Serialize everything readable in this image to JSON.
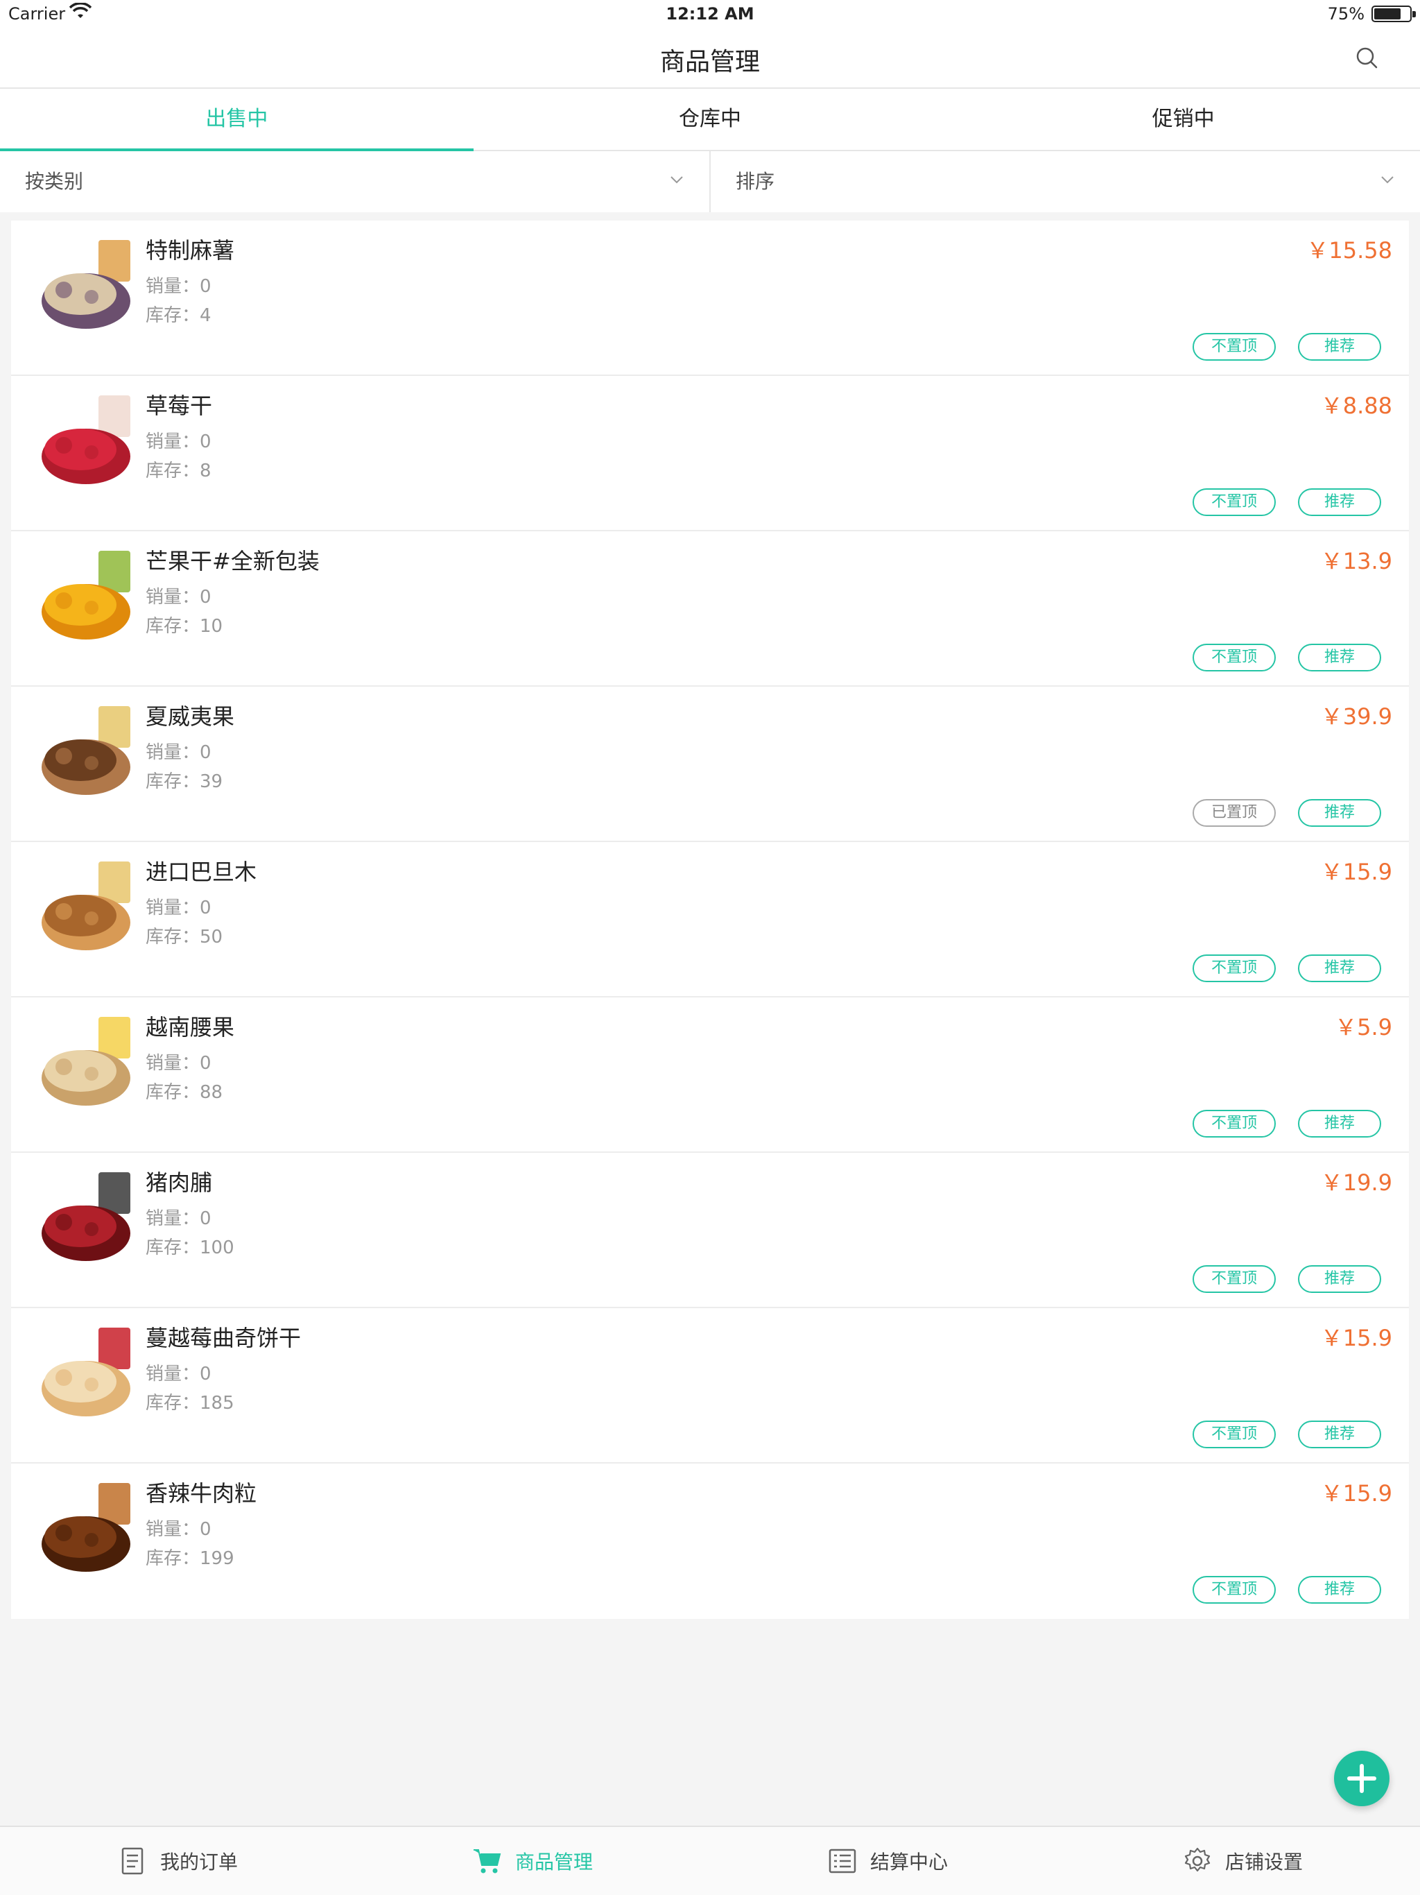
{
  "status_bar": {
    "carrier": "Carrier",
    "time": "12:12 AM",
    "battery": "75%"
  },
  "header": {
    "title": "商品管理"
  },
  "tabs": [
    {
      "label": "出售中"
    },
    {
      "label": "仓库中"
    },
    {
      "label": "促销中"
    }
  ],
  "filters": {
    "category": "按类别",
    "sort": "排序"
  },
  "labels": {
    "sales_prefix": "销量：",
    "stock_prefix": "库存：",
    "recommend": "推荐"
  },
  "products": [
    {
      "name": "特制麻薯",
      "price": "￥15.58",
      "sales": "销量：0",
      "stock": "库存：4",
      "pin": "不置顶",
      "recommend": "推荐",
      "pinned": false,
      "colors": [
        "#d9c6a8",
        "#6b4f6e",
        "#e0a24c"
      ]
    },
    {
      "name": "草莓干",
      "price": "￥8.88",
      "sales": "销量：0",
      "stock": "库存：8",
      "pin": "不置顶",
      "recommend": "推荐",
      "pinned": false,
      "colors": [
        "#d7263d",
        "#b01b2c",
        "#f0d9d0"
      ]
    },
    {
      "name": "芒果干#全新包装",
      "price": "￥13.9",
      "sales": "销量：0",
      "stock": "库存：10",
      "pin": "不置顶",
      "recommend": "推荐",
      "pinned": false,
      "colors": [
        "#f5b41a",
        "#e08a0b",
        "#8fb83a"
      ]
    },
    {
      "name": "夏威夷果",
      "price": "￥39.9",
      "sales": "销量：0",
      "stock": "库存：39",
      "pin": "已置顶",
      "recommend": "推荐",
      "pinned": true,
      "colors": [
        "#6b3e1f",
        "#b0784a",
        "#e6c76a"
      ]
    },
    {
      "name": "进口巴旦木",
      "price": "￥15.9",
      "sales": "销量：0",
      "stock": "库存：50",
      "pin": "不置顶",
      "recommend": "推荐",
      "pinned": false,
      "colors": [
        "#a8662c",
        "#d89a55",
        "#e8c66c"
      ]
    },
    {
      "name": "越南腰果",
      "price": "￥5.9",
      "sales": "销量：0",
      "stock": "库存：88",
      "pin": "不置顶",
      "recommend": "推荐",
      "pinned": false,
      "colors": [
        "#e9d3a8",
        "#caa26a",
        "#f4d04a"
      ]
    },
    {
      "name": "猪肉脯",
      "price": "￥19.9",
      "sales": "销量：0",
      "stock": "库存：100",
      "pin": "不置顶",
      "recommend": "推荐",
      "pinned": false,
      "colors": [
        "#b0202a",
        "#6e1014",
        "#3a3a3a"
      ]
    },
    {
      "name": "蔓越莓曲奇饼干",
      "price": "￥15.9",
      "sales": "销量：0",
      "stock": "库存：185",
      "pin": "不置顶",
      "recommend": "推荐",
      "pinned": false,
      "colors": [
        "#f2dcb4",
        "#e2b476",
        "#c8202a"
      ]
    },
    {
      "name": "香辣牛肉粒",
      "price": "￥15.9",
      "sales": "销量：0",
      "stock": "库存：199",
      "pin": "不置顶",
      "recommend": "推荐",
      "pinned": false,
      "colors": [
        "#7a3a14",
        "#4a1f08",
        "#c0702a"
      ]
    }
  ],
  "tabbar": [
    {
      "label": "我的订单",
      "icon": "orders-icon"
    },
    {
      "label": "商品管理",
      "icon": "cart-icon"
    },
    {
      "label": "结算中心",
      "icon": "settlement-icon"
    },
    {
      "label": "店铺设置",
      "icon": "settings-gear-icon"
    }
  ],
  "colors": {
    "accent": "#25c5a5",
    "price": "#ef7033",
    "muted": "#999999"
  }
}
